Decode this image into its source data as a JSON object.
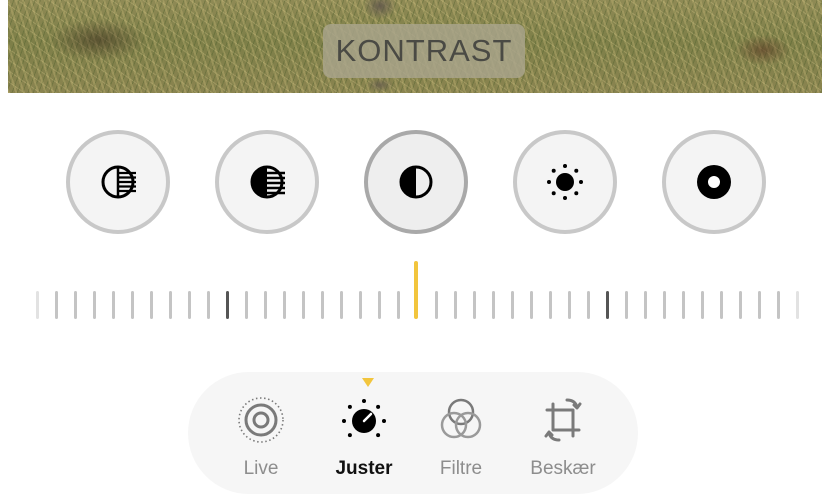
{
  "photo": {
    "label": "KONTRAST"
  },
  "adjustment_tools": [
    {
      "icon": "exposure-icon"
    },
    {
      "icon": "brilliance-icon"
    },
    {
      "icon": "contrast-icon",
      "selected": true
    },
    {
      "icon": "brightness-icon"
    },
    {
      "icon": "vignette-icon"
    }
  ],
  "slider": {
    "value": 0,
    "accent": "#f2c53d"
  },
  "tabs": [
    {
      "label": "Live",
      "icon": "live-photo-icon"
    },
    {
      "label": "Juster",
      "icon": "adjust-dial-icon",
      "selected": true
    },
    {
      "label": "Filtre",
      "icon": "filters-icon"
    },
    {
      "label": "Beskær",
      "icon": "crop-rotate-icon"
    }
  ]
}
